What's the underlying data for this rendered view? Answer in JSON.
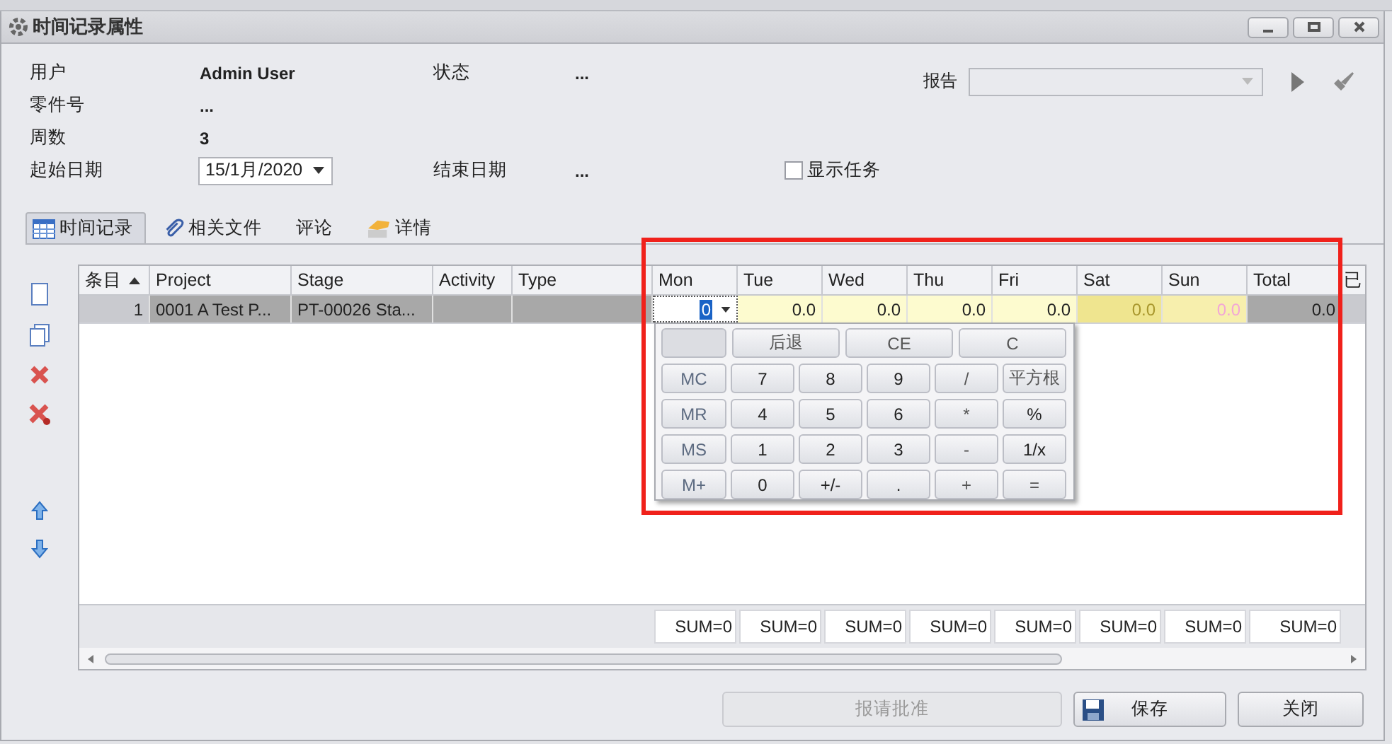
{
  "window": {
    "title": "时间记录属性"
  },
  "form": {
    "rows": [
      {
        "label": "用户",
        "value": "Admin User",
        "label2": "状态",
        "value2": "..."
      },
      {
        "label": "零件号",
        "value": "..."
      },
      {
        "label": "周数",
        "value": "3"
      },
      {
        "label": "起始日期",
        "date": "15/1月/2020",
        "label2": "结束日期",
        "value2": "..."
      }
    ],
    "show_tasks": {
      "label": "显示任务",
      "checked": false
    },
    "report": {
      "label": "报告"
    }
  },
  "tabs": [
    {
      "label": "时间记录",
      "selected": true
    },
    {
      "label": "相关文件",
      "selected": false
    },
    {
      "label": "评论",
      "selected": false
    },
    {
      "label": "详情",
      "selected": false
    }
  ],
  "table": {
    "columns": [
      {
        "label": "条目",
        "kind": "index",
        "sorted": true
      },
      {
        "label": "Project",
        "kind": "text",
        "sorted": false
      },
      {
        "label": "Stage",
        "kind": "text",
        "sorted": false
      },
      {
        "label": "Activity",
        "kind": "text",
        "sorted": false
      },
      {
        "label": "Type",
        "kind": "text",
        "sorted": false
      },
      {
        "label": "Mon",
        "kind": "weekday",
        "sorted": false
      },
      {
        "label": "Tue",
        "kind": "weekday",
        "sorted": false
      },
      {
        "label": "Wed",
        "kind": "weekday",
        "sorted": false
      },
      {
        "label": "Thu",
        "kind": "weekday",
        "sorted": false
      },
      {
        "label": "Fri",
        "kind": "weekday",
        "sorted": false
      },
      {
        "label": "Sat",
        "kind": "saturday",
        "sorted": false
      },
      {
        "label": "Sun",
        "kind": "sunday",
        "sorted": false
      },
      {
        "label": "Total",
        "kind": "total",
        "sorted": false
      },
      {
        "label": "已",
        "kind": "index",
        "sorted": false
      }
    ],
    "rows": [
      {
        "selected": true,
        "cells": [
          {
            "text": "1",
            "editing": false
          },
          {
            "text": "0001 A Test P...",
            "editing": false
          },
          {
            "text": "PT-00026 Sta...",
            "editing": false
          },
          {
            "editing": false
          },
          {
            "editing": false
          },
          {
            "text": "0",
            "editing": true
          },
          {
            "text": "0.0",
            "editing": false
          },
          {
            "text": "0.0",
            "editing": false
          },
          {
            "text": "0.0",
            "editing": false
          },
          {
            "text": "0.0",
            "editing": false
          },
          {
            "text": "0.0",
            "editing": false
          },
          {
            "text": "0.0",
            "editing": false
          },
          {
            "text": "0.0",
            "editing": false
          },
          {
            "editing": false
          }
        ]
      }
    ],
    "sums": [
      "SUM=0",
      "SUM=0",
      "SUM=0",
      "SUM=0",
      "SUM=0",
      "SUM=0",
      "SUM=0",
      "SUM=0"
    ]
  },
  "calculator": {
    "top_keys": [
      {
        "kind": "blank"
      },
      {
        "label": "后退",
        "kind": "op"
      },
      {
        "label": "CE",
        "kind": "op"
      },
      {
        "label": "C",
        "kind": "op"
      }
    ],
    "keys": [
      {
        "label": "MC",
        "kind": "memory"
      },
      {
        "label": "7",
        "kind": "digit"
      },
      {
        "label": "8",
        "kind": "digit"
      },
      {
        "label": "9",
        "kind": "digit"
      },
      {
        "label": "/",
        "kind": "op"
      },
      {
        "label": "平方根",
        "kind": "op"
      },
      {
        "label": "MR",
        "kind": "memory"
      },
      {
        "label": "4",
        "kind": "digit"
      },
      {
        "label": "5",
        "kind": "digit"
      },
      {
        "label": "6",
        "kind": "digit"
      },
      {
        "label": "*",
        "kind": "op"
      },
      {
        "label": "%",
        "kind": "digit"
      },
      {
        "label": "MS",
        "kind": "memory"
      },
      {
        "label": "1",
        "kind": "digit"
      },
      {
        "label": "2",
        "kind": "digit"
      },
      {
        "label": "3",
        "kind": "digit"
      },
      {
        "label": "-",
        "kind": "op"
      },
      {
        "label": "1/x",
        "kind": "digit"
      },
      {
        "label": "M+",
        "kind": "memory"
      },
      {
        "label": "0",
        "kind": "digit"
      },
      {
        "label": "+/-",
        "kind": "digit"
      },
      {
        "label": ".",
        "kind": "digit"
      },
      {
        "label": "+",
        "kind": "op"
      },
      {
        "label": "=",
        "kind": "op"
      }
    ]
  },
  "buttons": [
    {
      "label": "报请批准",
      "disabled": true
    },
    {
      "label": "保存",
      "disabled": false
    },
    {
      "label": "关闭",
      "disabled": false
    }
  ]
}
